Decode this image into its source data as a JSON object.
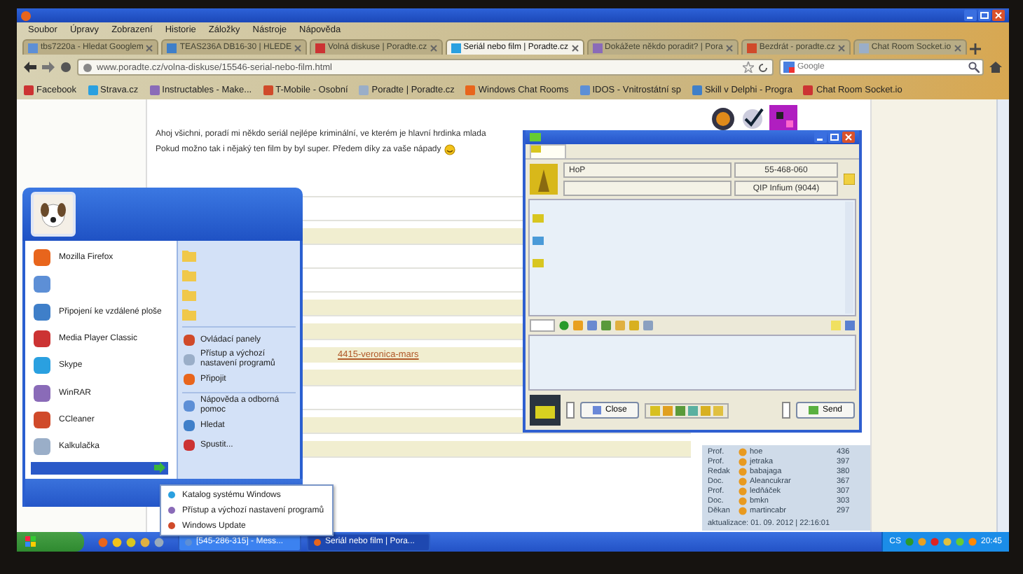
{
  "browser": {
    "menu": [
      "Soubor",
      "Úpravy",
      "Zobrazení",
      "Historie",
      "Záložky",
      "Nástroje",
      "Nápověda"
    ],
    "tabs": [
      {
        "label": "tbs7220a - Hledat Googlem",
        "selected": false
      },
      {
        "label": "TEAS236A DB16-30 | HLEDE",
        "selected": false
      },
      {
        "label": "Volná diskuse | Poradte.cz",
        "selected": false
      },
      {
        "label": "Seriál nebo film | Poradte.cz",
        "selected": true
      },
      {
        "label": "Dokážete někdo poradit? | Pora",
        "selected": false
      },
      {
        "label": "Bezdrát - poradte.cz",
        "selected": false
      },
      {
        "label": "Chat Room Socket.io",
        "selected": false
      }
    ],
    "url": "www.poradte.cz/volna-diskuse/15546-serial-nebo-film.html",
    "search": {
      "placeholder": "Google"
    },
    "bookmarks": [
      "Facebook",
      "Strava.cz",
      "Instructables - Make...",
      "T-Mobile - Osobní",
      "Poradte | Poradte.cz",
      "Windows Chat Rooms",
      "IDOS - Vnitrostátní sp",
      "Skill v Delphi - Progra",
      "Chat Room Socket.io"
    ],
    "post": [
      "Ahoj všichni, poradí mi někdo seriál nejlépe kriminální, ve kterém je hlavní hrdinka mlada",
      "Pokud možno tak i nějaký ten film by byl super.  Předem díky za vaše nápady"
    ],
    "link": "4415-veronica-mars",
    "ranking": {
      "rows": [
        {
          "rank": "Prof.",
          "name": "hoe",
          "points": "436"
        },
        {
          "rank": "Prof.",
          "name": "jetraka",
          "points": "397"
        },
        {
          "rank": "Redak",
          "name": "babajaga",
          "points": "380"
        },
        {
          "rank": "Doc.",
          "name": "Aleancukrar",
          "points": "367"
        },
        {
          "rank": "Prof.",
          "name": "ledňáček",
          "points": "307"
        },
        {
          "rank": "Doc.",
          "name": "bmkn",
          "points": "303"
        },
        {
          "rank": "Děkan",
          "name": "martincabr",
          "points": "297"
        }
      ],
      "updated": "aktualizace: 01. 09. 2012 | 22:16:01"
    }
  },
  "start_menu": {
    "programs": [
      {
        "kind": "item",
        "label": "Mozilla Firefox"
      },
      {
        "kind": "icon"
      },
      {
        "kind": "item",
        "label": "Připojení ke vzdálené ploše"
      },
      {
        "kind": "item",
        "label": "Media Player Classic"
      },
      {
        "kind": "item",
        "label": "Skype"
      },
      {
        "kind": "item",
        "label": "WinRAR"
      },
      {
        "kind": "item",
        "label": "CCleaner"
      },
      {
        "kind": "item",
        "label": "Kalkulačka"
      }
    ],
    "places": [
      {
        "kind": "folder"
      },
      {
        "kind": "folder"
      },
      {
        "kind": "folder"
      },
      {
        "kind": "folder"
      },
      {
        "label": "Ovládací panely"
      },
      {
        "label": "Přístup a výchozí nastavení programů"
      },
      {
        "label": "Připojit"
      },
      {
        "label": "Nápověda a odborná pomoc"
      },
      {
        "label": "Hledat"
      },
      {
        "label": "Spustit..."
      }
    ],
    "submenu": [
      "Katalog systému Windows",
      "Přístup a výchozí nastavení programů",
      "Windows Update"
    ]
  },
  "chat": {
    "contact": "HoP",
    "number": "55-468-060",
    "client": "QIP Infium (9044)",
    "close": "Close",
    "send": "Send"
  },
  "taskbar": {
    "buttons": [
      {
        "label": "[545-286-315] - Mess...",
        "selected": false
      },
      {
        "label": "Seriál nebo film | Pora...",
        "selected": true
      }
    ],
    "language": "CS",
    "clock": "20:45"
  }
}
